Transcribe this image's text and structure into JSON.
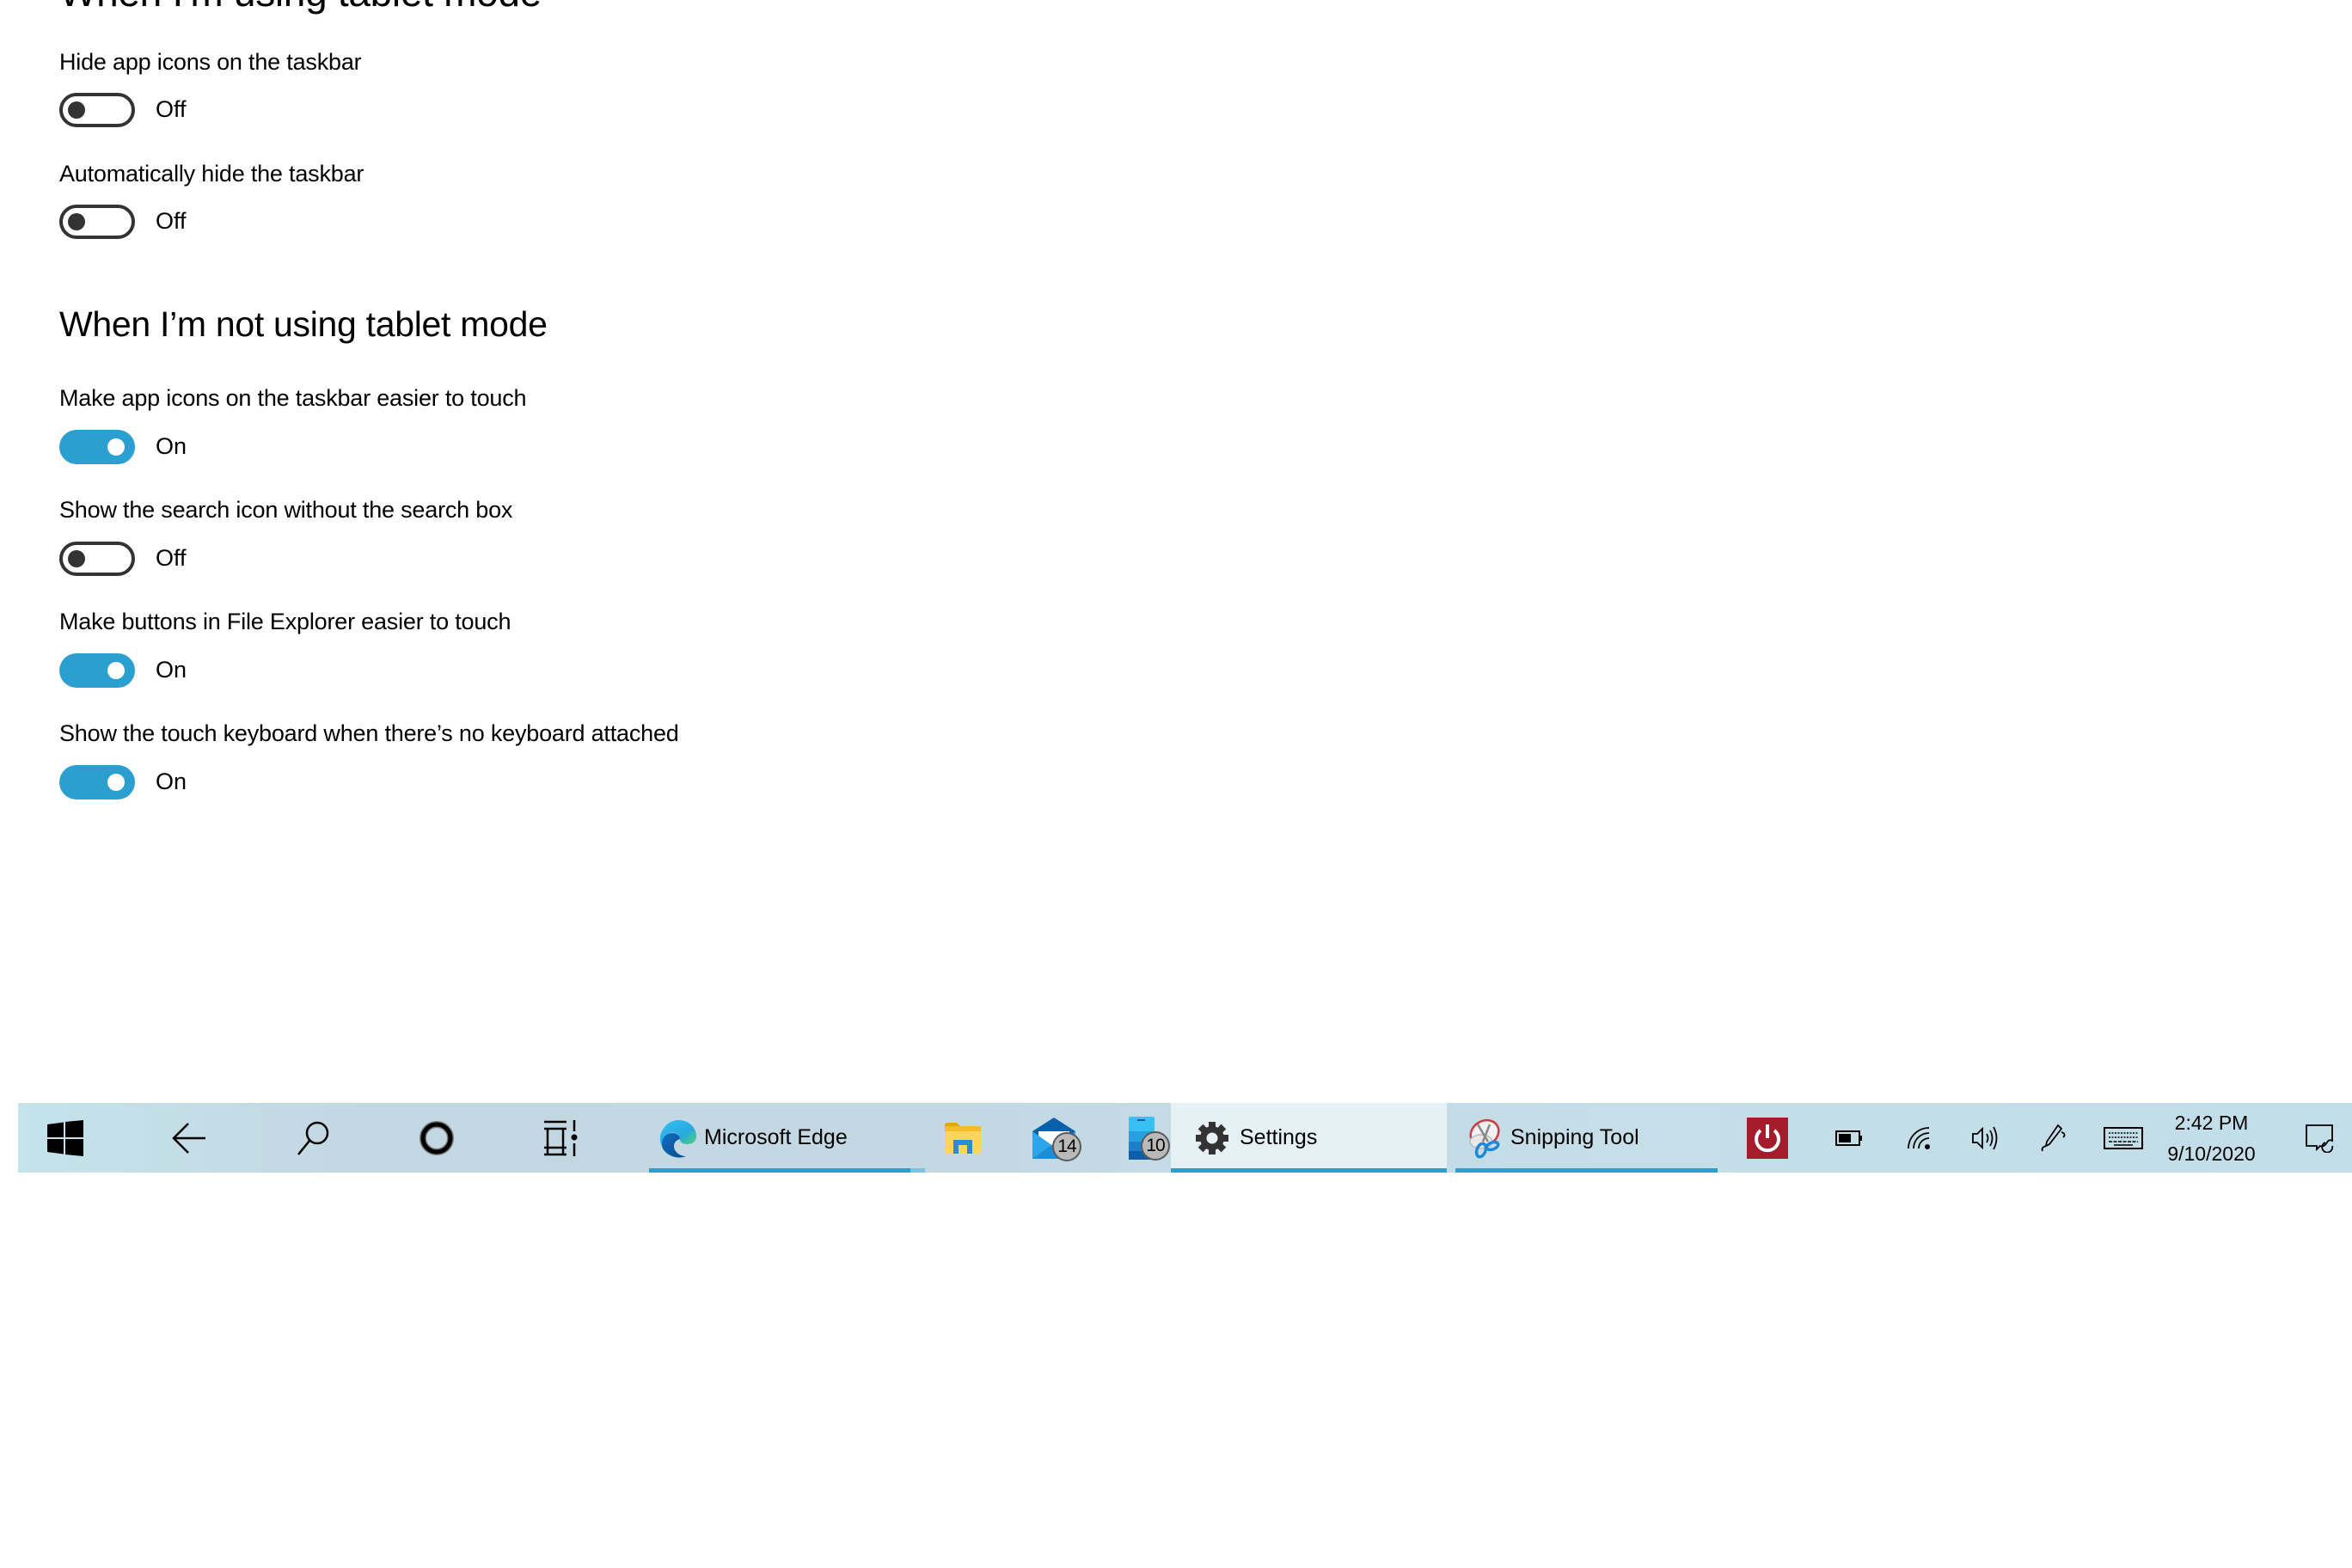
{
  "settings": {
    "partial_heading": "When I'm using tablet mode",
    "group1": [
      {
        "label": "Hide app icons on the taskbar",
        "state": "Off",
        "on": false
      },
      {
        "label": "Automatically hide the taskbar",
        "state": "Off",
        "on": false
      }
    ],
    "section_heading": "When I’m not using tablet mode",
    "group2": [
      {
        "label": "Make app icons on the taskbar easier to touch",
        "state": "On",
        "on": true
      },
      {
        "label": "Show the search icon without the search box",
        "state": "Off",
        "on": false
      },
      {
        "label": "Make buttons in File Explorer easier to touch",
        "state": "On",
        "on": true
      },
      {
        "label": "Show the touch keyboard when there’s no keyboard attached",
        "state": "On",
        "on": true
      }
    ],
    "accent_color": "#2a9fd0"
  },
  "taskbar": {
    "start_icon": "windows-logo-icon",
    "back_icon": "back-arrow-icon",
    "search_icon": "search-icon",
    "cortana_icon": "cortana-circle-icon",
    "task_view_icon": "task-view-icon",
    "apps": {
      "edge": {
        "label": "Microsoft Edge",
        "icon": "edge-icon"
      },
      "file_explorer": {
        "icon": "folder-icon"
      },
      "mail": {
        "icon": "mail-icon",
        "badge": "14"
      },
      "phone": {
        "icon": "phone-icon",
        "badge": "10"
      },
      "settings": {
        "label": "Settings",
        "icon": "gear-icon"
      },
      "snipping": {
        "label": "Snipping Tool",
        "icon": "snipping-tool-icon"
      }
    },
    "tray": {
      "power_icon": "power-icon",
      "battery_icon": "battery-icon",
      "network_icon": "wifi-icon",
      "volume_icon": "volume-icon",
      "pen_icon": "pen-icon",
      "keyboard_icon": "touch-keyboard-icon",
      "time": "2:42 PM",
      "date": "9/10/2020",
      "notification_icon": "action-center-icon"
    }
  }
}
